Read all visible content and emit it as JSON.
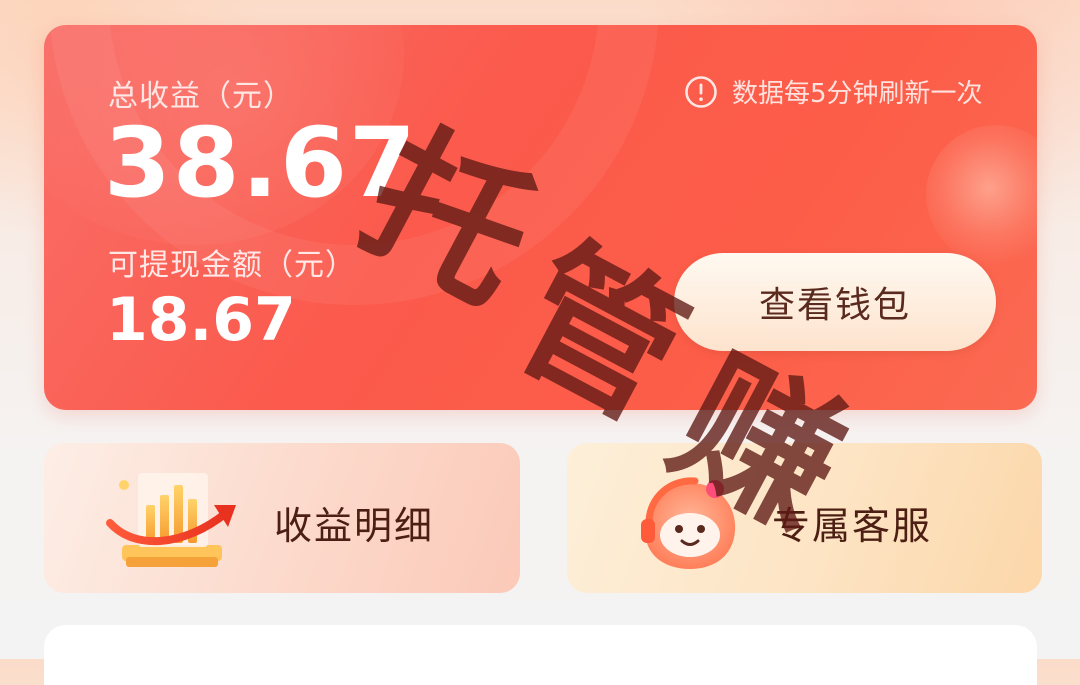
{
  "earnings": {
    "total_label": "总收益（元）",
    "total_value": "38.67",
    "withdraw_label": "可提现金额（元）",
    "withdraw_value": "18.67",
    "refresh_note": "数据每5分钟刷新一次",
    "wallet_button": "查看钱包"
  },
  "actions": {
    "income_detail": "收益明细",
    "customer_service": "专属客服"
  },
  "watermark": {
    "chars": [
      "托",
      "管",
      "赚"
    ]
  },
  "colors": {
    "card_red": "#fb5a4c",
    "button_text": "#5a2a1e",
    "label_text": "#4d1f14"
  },
  "icons": {
    "refresh_note": "info-circle-icon",
    "income_detail": "chart-growth-icon",
    "customer_service": "mascot-headset-icon"
  }
}
